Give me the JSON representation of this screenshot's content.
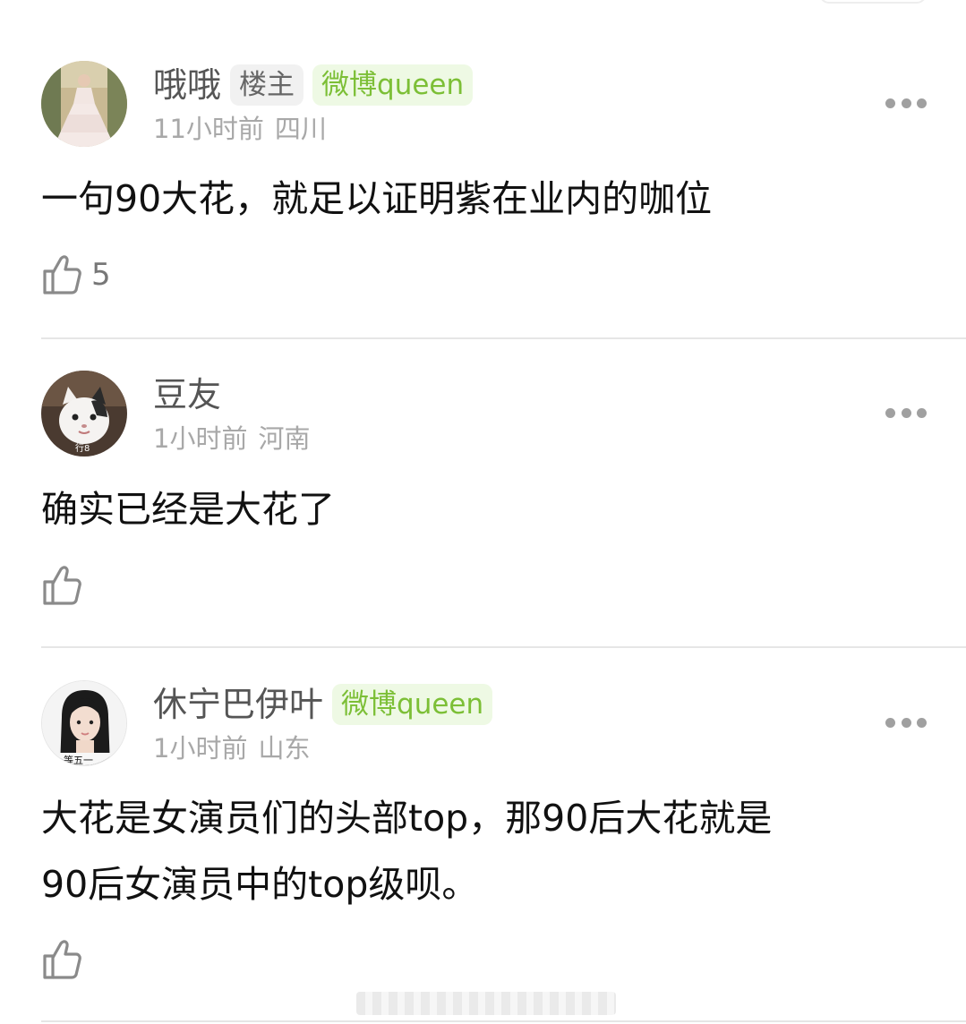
{
  "comments": [
    {
      "username": "哦哦",
      "badges": [
        "楼主",
        "微博queen"
      ],
      "time": "11小时前",
      "location": "四川",
      "text": "一句90大花，就足以证明紫在业内的咖位",
      "likes": "5",
      "avatar_icon": "avatar-woman-in-gown-icon"
    },
    {
      "username": "豆友",
      "time": "1小时前",
      "location": "河南",
      "text": "确实已经是大花了",
      "likes": "",
      "avatar_icon": "avatar-cat-icon",
      "avatar_caption": "行8"
    },
    {
      "username": "休宁巴伊叶",
      "badges": [
        "微博queen"
      ],
      "time": "1小时前",
      "location": "山东",
      "text_line1": "大花是女演员们的头部top，那90后大花就是",
      "text_line2": "90后女演员中的top级呗。",
      "likes": "",
      "avatar_icon": "avatar-girl-portrait-icon",
      "avatar_caption": "等五一"
    }
  ],
  "colors": {
    "queen_badge_text": "#7cbf36",
    "queen_badge_bg": "#eef9e4",
    "meta_text": "#a8a8a8"
  }
}
